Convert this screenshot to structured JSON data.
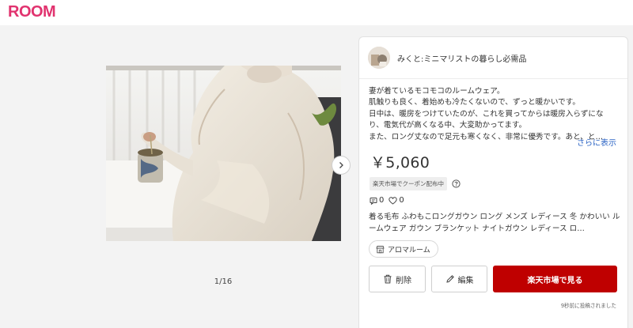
{
  "header": {
    "logo": "ROOM"
  },
  "gallery": {
    "counter": "1/16"
  },
  "user": {
    "name": "みくと:ミニマリストの暮らし必需品"
  },
  "description": {
    "lines": [
      "妻が着ているモコモコのルームウェア。",
      "肌触りも良く、着始めも冷たくないので、ずっと暖かいです。",
      "日中は、暖房をつけていたのが、これを買ってからは暖房入らずにな",
      "り、電気代が高くなる中、大変助かってます。",
      "また、ロング丈なので足元も寒くなく、非常に優秀です。あと、と…"
    ],
    "more": "さらに表示"
  },
  "price": "￥5,060",
  "coupon": "楽天市場でクーポン配布中",
  "stats": {
    "comments": "0",
    "likes": "0"
  },
  "item_title": "着る毛布 ふわもこロングガウン ロング メンズ レディース 冬 かわいい ルームウェア ガウン ブランケット ナイトガウン レディース ロ…",
  "shop": "アロマルーム",
  "buttons": {
    "delete": "削除",
    "edit": "編集",
    "rakuten": "楽天市場で見る"
  },
  "posted": "9秒前に投稿されました",
  "colors": {
    "brand": "#e1336f",
    "rakuten_red": "#bf0000",
    "link": "#2a63c4"
  }
}
